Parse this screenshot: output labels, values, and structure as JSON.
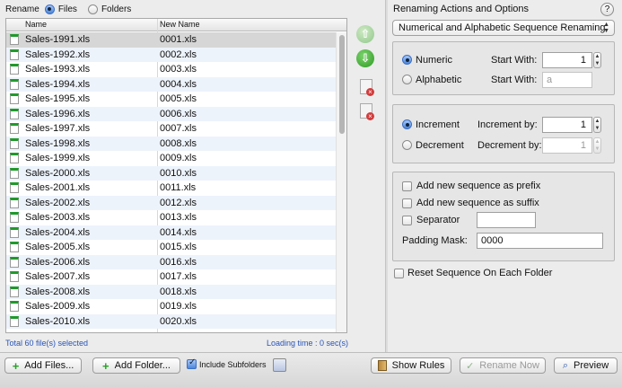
{
  "rename_bar": {
    "label": "Rename",
    "files_label": "Files",
    "folders_label": "Folders",
    "selected": "files"
  },
  "table": {
    "columns": [
      "Name",
      "New Name"
    ],
    "rows": [
      {
        "name": "Sales-1991.xls",
        "new_name": "0001.xls",
        "selected": true
      },
      {
        "name": "Sales-1992.xls",
        "new_name": "0002.xls"
      },
      {
        "name": "Sales-1993.xls",
        "new_name": "0003.xls"
      },
      {
        "name": "Sales-1994.xls",
        "new_name": "0004.xls"
      },
      {
        "name": "Sales-1995.xls",
        "new_name": "0005.xls"
      },
      {
        "name": "Sales-1996.xls",
        "new_name": "0006.xls"
      },
      {
        "name": "Sales-1997.xls",
        "new_name": "0007.xls"
      },
      {
        "name": "Sales-1998.xls",
        "new_name": "0008.xls"
      },
      {
        "name": "Sales-1999.xls",
        "new_name": "0009.xls"
      },
      {
        "name": "Sales-2000.xls",
        "new_name": "0010.xls"
      },
      {
        "name": "Sales-2001.xls",
        "new_name": "0011.xls"
      },
      {
        "name": "Sales-2002.xls",
        "new_name": "0012.xls"
      },
      {
        "name": "Sales-2003.xls",
        "new_name": "0013.xls"
      },
      {
        "name": "Sales-2004.xls",
        "new_name": "0014.xls"
      },
      {
        "name": "Sales-2005.xls",
        "new_name": "0015.xls"
      },
      {
        "name": "Sales-2006.xls",
        "new_name": "0016.xls"
      },
      {
        "name": "Sales-2007.xls",
        "new_name": "0017.xls"
      },
      {
        "name": "Sales-2008.xls",
        "new_name": "0018.xls"
      },
      {
        "name": "Sales-2009.xls",
        "new_name": "0019.xls"
      },
      {
        "name": "Sales-2010.xls",
        "new_name": "0020.xls"
      }
    ]
  },
  "status": {
    "total": "Total 60 file(s) selected",
    "loading": "Loading time : 0 sec(s)"
  },
  "side_actions": {
    "up_icon": "arrow-up-icon",
    "down_icon": "arrow-down-icon",
    "remove_icon": "remove-file-icon",
    "up_glyph": "⇧",
    "down_glyph": "⇩"
  },
  "options": {
    "title": "Renaming Actions and Options",
    "help": "?",
    "action_selected": "Numerical and Alphabetic Sequence Renaming",
    "numeric_label": "Numeric",
    "alphabetic_label": "Alphabetic",
    "sequence_type": "numeric",
    "start_with_label": "Start With:",
    "numeric_start": "1",
    "alpha_start": "a",
    "increment_label": "Increment",
    "decrement_label": "Decrement",
    "step_mode": "increment",
    "increment_by_label": "Increment by:",
    "increment_by": "1",
    "decrement_by_label": "Decrement by:",
    "decrement_by": "1",
    "prefix_label": "Add new sequence as prefix",
    "suffix_label": "Add new sequence as suffix",
    "separator_label": "Separator",
    "separator_value": "",
    "padding_label": "Padding Mask:",
    "padding_value": "0000",
    "reset_label": "Reset Sequence On Each Folder"
  },
  "toolbar": {
    "add_files": "Add Files...",
    "add_folder": "Add Folder...",
    "include_subfolders": "Include Subfolders",
    "include_subfolders_checked": true,
    "show_rules": "Show Rules",
    "rename_now": "Rename Now",
    "preview": "Preview"
  },
  "colors": {
    "status_blue": "#2a55b8",
    "accent_green": "#2c9a22",
    "selected_row": "#d6d6d6"
  }
}
